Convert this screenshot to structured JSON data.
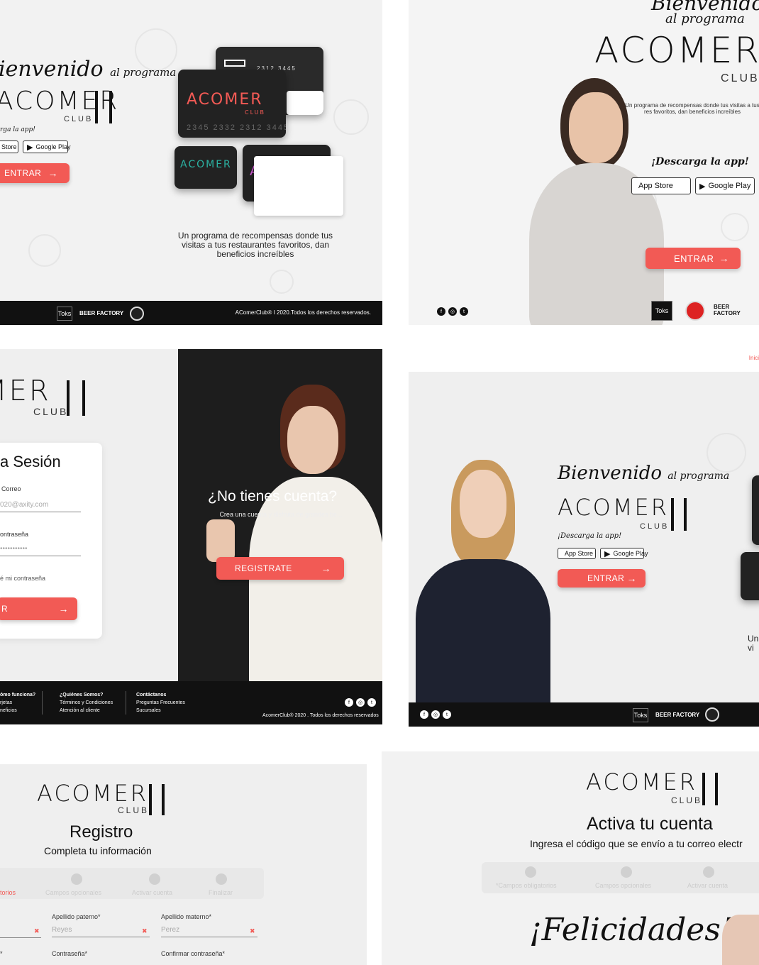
{
  "brand": {
    "name": "ACOMER",
    "club": "CLUB"
  },
  "landing1": {
    "welcome": "ienvenido",
    "welcome_small": "al programa",
    "download": "rga la app!",
    "appstore": "Store",
    "googleplay": "Google Play",
    "enter": "ENTRAR",
    "tagline": "Un programa de recompensas donde tus visitas a tus restaurantes favoritos, dan beneficios increíbles",
    "card_numbers": "2345  2332  2312  3445",
    "footer_copy": "AComerClub® I 2020.Todos los derechos reservados.",
    "logo_toks": "Toks",
    "logo_beer": "BEER FACTORY"
  },
  "landing2": {
    "welcome": "Bienvenido",
    "welcome_small": "al programa",
    "tagline": "Un programa de recompensas donde tus visitas a tus res favoritos, dan beneficios increíbles",
    "download": "¡Descarga la app!",
    "appstore": "App Store",
    "googleplay": "Google Play",
    "enter": "ENTRAR",
    "logo_toks": "Toks",
    "logo_beer": "BEER FACTORY"
  },
  "login": {
    "title": "a Sesión",
    "email_label": "Correo",
    "email_placeholder": "020@axity.com",
    "password_label": "ontraseña",
    "password_value": "•••••••••••",
    "forgot": "é mi contraseña",
    "submit": "R",
    "no_account": "¿No tienes cuenta?",
    "no_account_sub": "Crea una cuenta y disfruta de grandes be...",
    "register": "REGISTRATE",
    "footer": {
      "col1": [
        "ómo funciona?",
        "rjetas",
        "neficios"
      ],
      "col2": [
        "¿Quiénes Somos?",
        "Términos y Condiciones",
        "Atención al cliente"
      ],
      "col3": [
        "Contáctanos",
        "Preguntas Frecuentes",
        "Sucursales"
      ],
      "copy": "AcomerClub® 2020 . Todos los derechos reservados"
    }
  },
  "landing3": {
    "nav_link": "Inici",
    "welcome": "Bienvenido",
    "welcome_small": "al programa",
    "download": "¡Descarga la app!",
    "appstore": "App Store",
    "googleplay": "Google Play",
    "enter": "ENTRAR",
    "side_text1": "Un",
    "side_text2": "vi",
    "logo_toks": "Toks",
    "logo_beer": "BEER FACTORY"
  },
  "register": {
    "title": "Registro",
    "subtitle": "Completa tu información",
    "steps": [
      "torios",
      "Campos opcionales",
      "Activar cuenta",
      "Finalizar"
    ],
    "last_paternal_label": "Apellido paterno*",
    "last_paternal_value": "Reyes",
    "last_maternal_label": "Apellido materno*",
    "last_maternal_value": "Perez",
    "password_label_left": "*",
    "password_label": "Contraseña*",
    "confirm_label": "Confirmar contraseña*"
  },
  "activate": {
    "title": "Activa tu cuenta",
    "subtitle": "Ingresa el código que se envío a tu correo electr",
    "steps": [
      "*Campos obligatorios",
      "Campos opcionales",
      "Activar cuenta"
    ],
    "congrats": "¡Felicidades!"
  },
  "colors": {
    "accent": "#f25a55",
    "dark": "#111111",
    "panel": "#f2f2f2",
    "teal": "#2bb3a3",
    "magenta": "#c455c9"
  }
}
